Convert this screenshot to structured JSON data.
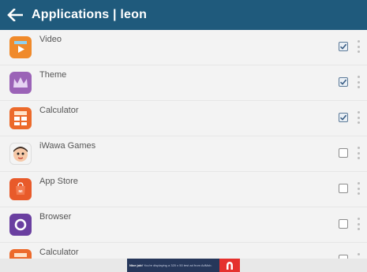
{
  "header": {
    "title": "Applications | leon",
    "background": "#1f5a7c"
  },
  "apps": [
    {
      "name": "Video",
      "checked": true,
      "icon": "video-app-icon",
      "color": "#f08a2b"
    },
    {
      "name": "Theme",
      "checked": true,
      "icon": "theme-app-icon",
      "color": "#9b63b7"
    },
    {
      "name": "Calculator",
      "checked": true,
      "icon": "calculator-app-icon",
      "color": "#ec6a2b"
    },
    {
      "name": "iWawa Games",
      "checked": false,
      "icon": "iwawa-games-app-icon",
      "color": "#f4f4f4"
    },
    {
      "name": "App Store",
      "checked": false,
      "icon": "app-store-app-icon",
      "color": "#e85a2a"
    },
    {
      "name": "Browser",
      "checked": false,
      "icon": "browser-app-icon",
      "color": "#6a3fa0"
    },
    {
      "name": "Calculator",
      "checked": false,
      "icon": "calculator-app-icon",
      "color": "#ec6a2b"
    }
  ],
  "ad": {
    "lead": "Nice job!",
    "text": "You're displaying a 320 x 50 test ad from AdMob.",
    "logo": "admob-logo"
  }
}
